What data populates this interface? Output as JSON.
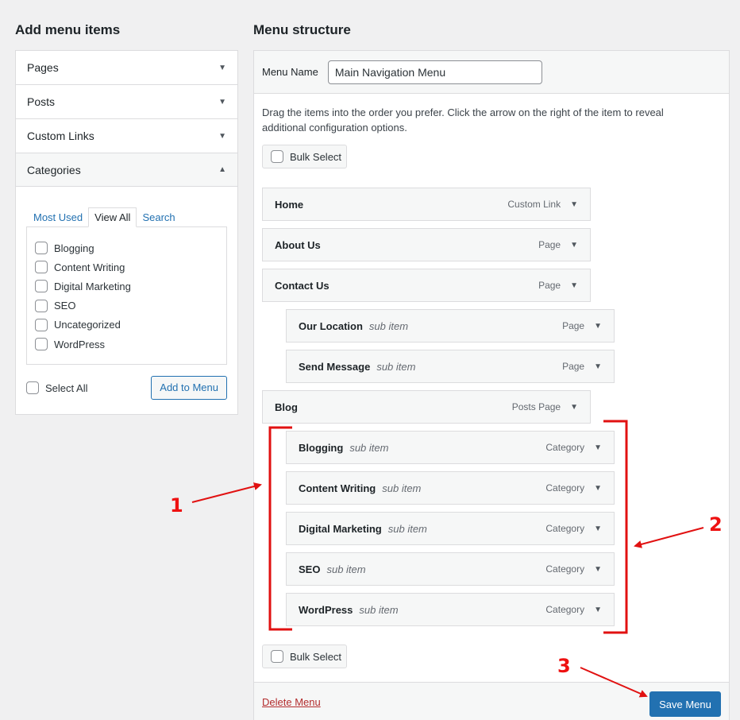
{
  "left": {
    "heading": "Add menu items",
    "sections": [
      {
        "label": "Pages"
      },
      {
        "label": "Posts"
      },
      {
        "label": "Custom Links"
      },
      {
        "label": "Categories"
      }
    ],
    "tabs": [
      "Most Used",
      "View All",
      "Search"
    ],
    "categories": [
      "Blogging",
      "Content Writing",
      "Digital Marketing",
      "SEO",
      "Uncategorized",
      "WordPress"
    ],
    "select_all": "Select All",
    "add_button": "Add to Menu"
  },
  "right": {
    "heading": "Menu structure",
    "menu_name_label": "Menu Name",
    "menu_name_value": "Main Navigation Menu",
    "instructions": "Drag the items into the order you prefer. Click the arrow on the right of the item to reveal additional configuration options.",
    "bulk_select": "Bulk Select",
    "items": [
      {
        "title": "Home",
        "sub": "",
        "type": "Custom Link"
      },
      {
        "title": "About Us",
        "sub": "",
        "type": "Page"
      },
      {
        "title": "Contact Us",
        "sub": "",
        "type": "Page"
      },
      {
        "title": "Our Location",
        "sub": "sub item",
        "type": "Page"
      },
      {
        "title": "Send Message",
        "sub": "sub item",
        "type": "Page"
      },
      {
        "title": "Blog",
        "sub": "",
        "type": "Posts Page"
      },
      {
        "title": "Blogging",
        "sub": "sub item",
        "type": "Category"
      },
      {
        "title": "Content Writing",
        "sub": "sub item",
        "type": "Category"
      },
      {
        "title": "Digital Marketing",
        "sub": "sub item",
        "type": "Category"
      },
      {
        "title": "SEO",
        "sub": "sub item",
        "type": "Category"
      },
      {
        "title": "WordPress",
        "sub": "sub item",
        "type": "Category"
      }
    ],
    "delete_link": "Delete Menu",
    "save_button": "Save Menu"
  },
  "annotations": {
    "one": "1",
    "two": "2",
    "three": "3"
  },
  "colors": {
    "accent": "#2271b1",
    "delete": "#b32d2e",
    "annotation": "#e11111"
  },
  "icons": {
    "collapsed": "▼",
    "expanded": "▲"
  }
}
